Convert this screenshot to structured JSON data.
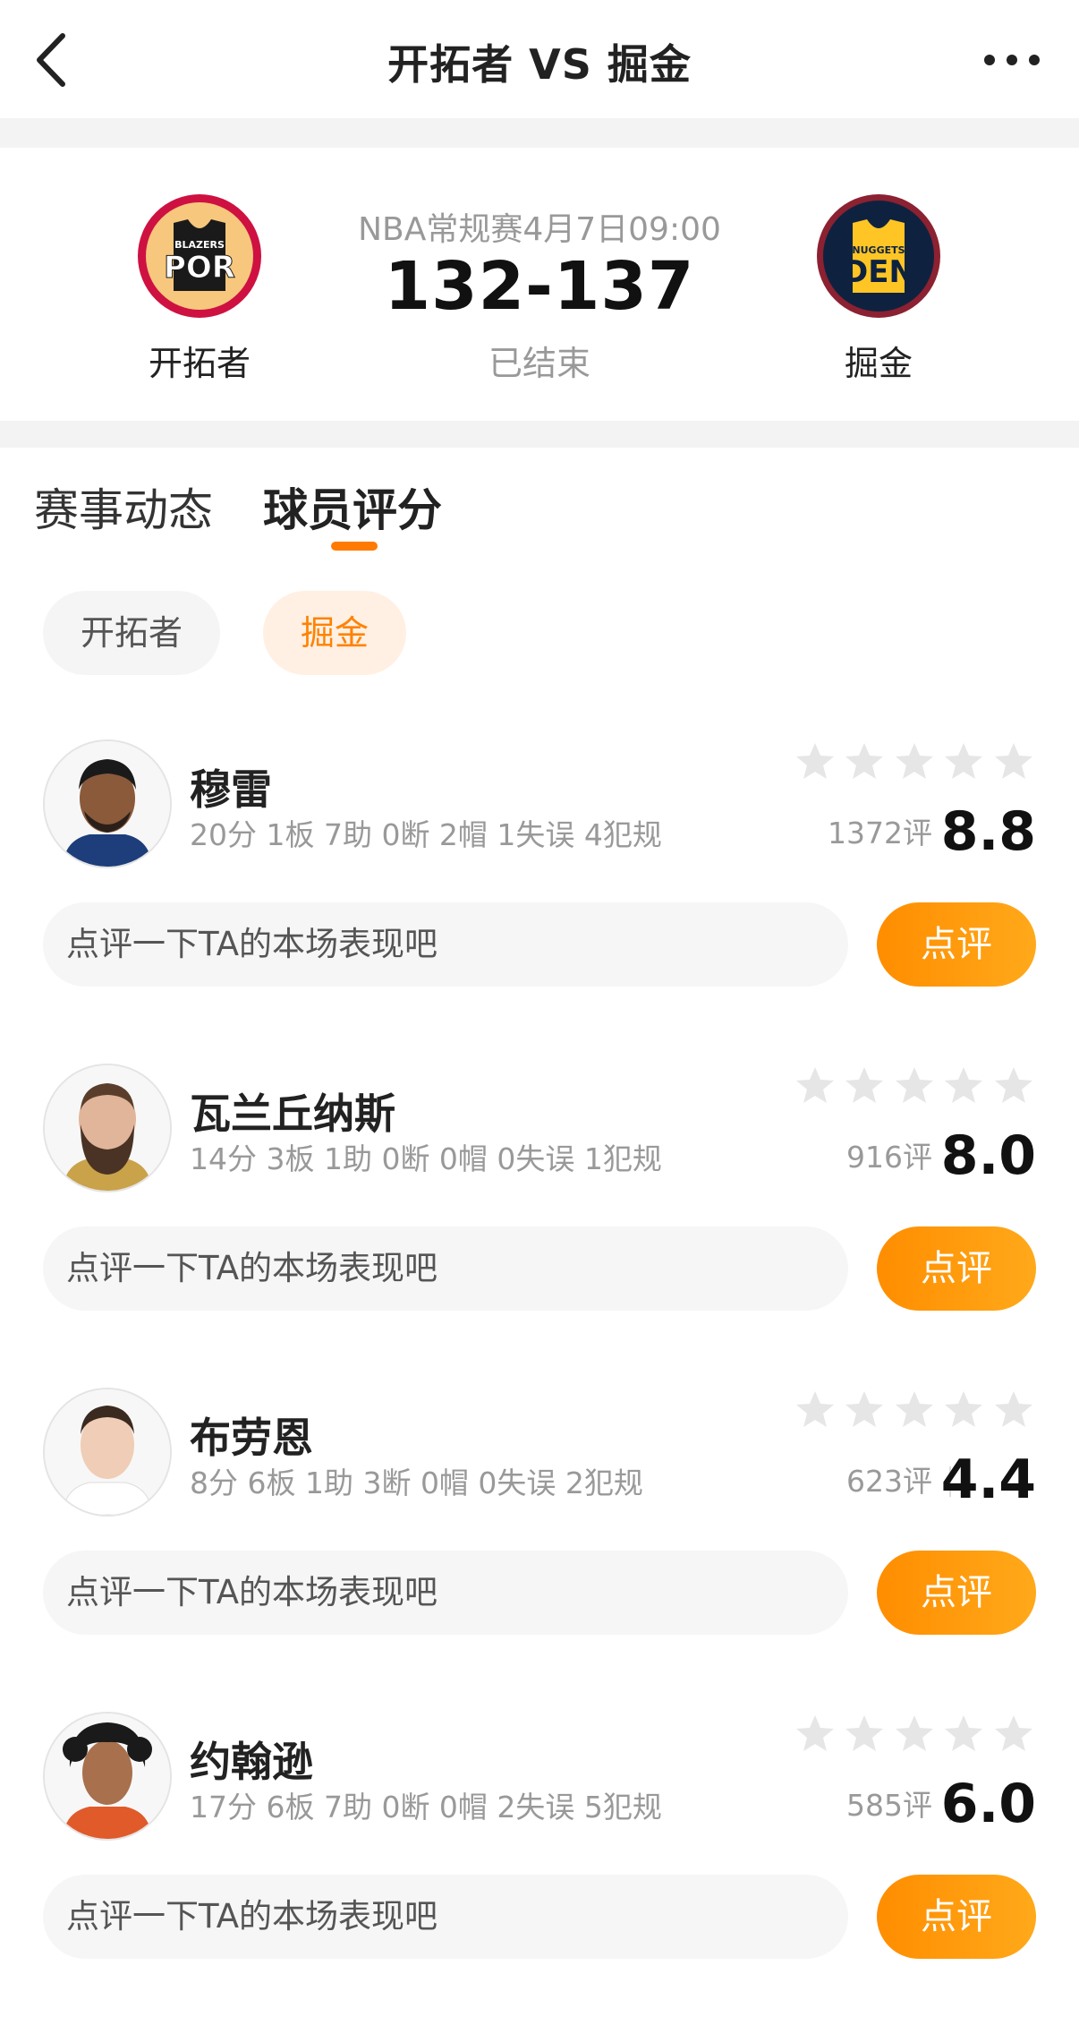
{
  "header": {
    "title": "开拓者 VS 掘金"
  },
  "match": {
    "league_time": "NBA常规赛4月7日09:00",
    "score": "132-137",
    "status": "已结束",
    "home": {
      "name": "开拓者",
      "logo_top": "BLAZERS",
      "logo_abbr": "POR"
    },
    "away": {
      "name": "掘金",
      "logo_top": "NUGGETS",
      "logo_abbr": "DEN"
    }
  },
  "tabs": [
    {
      "label": "赛事动态",
      "active": false
    },
    {
      "label": "球员评分",
      "active": true
    }
  ],
  "team_filter": [
    {
      "label": "开拓者",
      "active": false
    },
    {
      "label": "掘金",
      "active": true
    }
  ],
  "players": [
    {
      "name": "穆雷",
      "stats": "20分 1板 7助 0断 2帽 1失误 4犯规",
      "count": "1372评",
      "rating": "8.8",
      "comment_placeholder": "点评一下TA的本场表现吧",
      "button": "点评"
    },
    {
      "name": "瓦兰丘纳斯",
      "stats": "14分 3板 1助 0断 0帽 0失误 1犯规",
      "count": "916评",
      "rating": "8.0",
      "comment_placeholder": "点评一下TA的本场表现吧",
      "button": "点评"
    },
    {
      "name": "布劳恩",
      "stats": "8分 6板 1助 3断 0帽 0失误 2犯规",
      "count": "623评",
      "rating": "4.4",
      "comment_placeholder": "点评一下TA的本场表现吧",
      "button": "点评"
    },
    {
      "name": "约翰逊",
      "stats": "17分 6板 7助 0断 0帽 2失误 5犯规",
      "count": "585评",
      "rating": "6.0",
      "comment_placeholder": "点评一下TA的本场表现吧",
      "button": "点评"
    }
  ],
  "colors": {
    "accent": "#ff8200",
    "blazers_red": "#ce1141",
    "nuggets_navy": "#0e2240",
    "nuggets_gold": "#fec524"
  }
}
